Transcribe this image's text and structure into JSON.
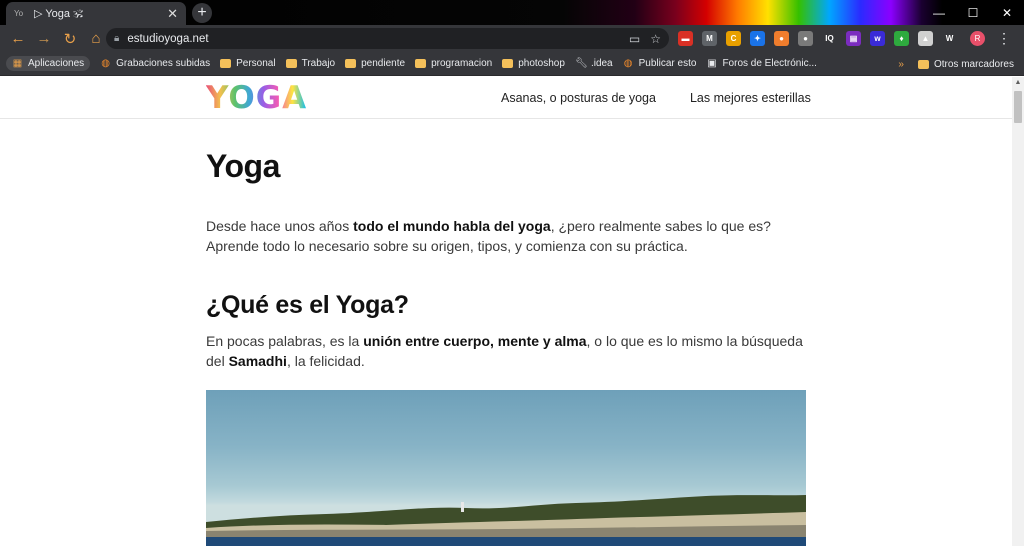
{
  "browser": {
    "tab_title": "▷ Yoga 🕉",
    "tab_favicon_text": "Yo",
    "url": "estudioyoga.net",
    "extensions": [
      {
        "name": "pdf-icon",
        "color": "#d93025",
        "glyph": "▬"
      },
      {
        "name": "gmail-icon",
        "color": "#5f6368",
        "glyph": "M"
      },
      {
        "name": "coin-icon",
        "color": "#e8a000",
        "glyph": "C"
      },
      {
        "name": "puzzle-blue-icon",
        "color": "#1a73e8",
        "glyph": "✦"
      },
      {
        "name": "orange-circle-icon",
        "color": "#ef7d2d",
        "glyph": "●"
      },
      {
        "name": "gray-circle-icon",
        "color": "#7a7a7a",
        "glyph": "●"
      },
      {
        "name": "iq-icon",
        "color": "#35363a",
        "glyph": "IQ"
      },
      {
        "name": "purple-box-icon",
        "color": "#7b2cbf",
        "glyph": "▤"
      },
      {
        "name": "wave-icon",
        "color": "#3a2bd8",
        "glyph": "w"
      },
      {
        "name": "green-leaf-icon",
        "color": "#2eaa3e",
        "glyph": "♦"
      },
      {
        "name": "photo-icon",
        "color": "#d0d0d0",
        "glyph": "▲"
      },
      {
        "name": "wf-icon",
        "color": "#35363a",
        "glyph": "W"
      }
    ],
    "profile_initial": "R",
    "bookmarks": [
      {
        "label": "Aplicaciones",
        "icon": "apps-grid-icon",
        "type": "apps"
      },
      {
        "label": "Grabaciones subidas",
        "icon": "globe-icon",
        "type": "globe"
      },
      {
        "label": "Personal",
        "icon": "folder-icon",
        "type": "folder"
      },
      {
        "label": "Trabajo",
        "icon": "folder-icon",
        "type": "folder"
      },
      {
        "label": "pendiente",
        "icon": "folder-icon",
        "type": "folder"
      },
      {
        "label": "programacion",
        "icon": "folder-icon",
        "type": "folder"
      },
      {
        "label": "photoshop",
        "icon": "folder-icon",
        "type": "folder"
      },
      {
        "label": ".idea",
        "icon": "wrench-icon",
        "type": "tool"
      },
      {
        "label": "Publicar esto",
        "icon": "globe-icon",
        "type": "globe"
      },
      {
        "label": "Foros de Electrónic...",
        "icon": "forum-icon",
        "type": "forum"
      }
    ],
    "other_bookmarks": "Otros marcadores",
    "overflow_glyph": "»"
  },
  "site": {
    "logo": "YOGA",
    "nav": [
      "Asanas, o posturas de yoga",
      "Las mejores esterillas"
    ]
  },
  "article": {
    "title": "Yoga",
    "intro": {
      "before": "Desde hace unos años ",
      "bold": "todo el mundo habla del yoga",
      "after": ", ¿pero realmente sabes lo que es? Aprende todo lo necesario sobre su origen, tipos, y comienza con su práctica."
    },
    "section_title": "¿Qué es el Yoga?",
    "definition": {
      "before": "En pocas palabras, es la ",
      "bold1": "unión entre cuerpo, mente y alma",
      "middle": ", o lo que es lo mismo la búsqueda del ",
      "bold2": "Samadhi",
      "after": ", la felicidad."
    }
  }
}
